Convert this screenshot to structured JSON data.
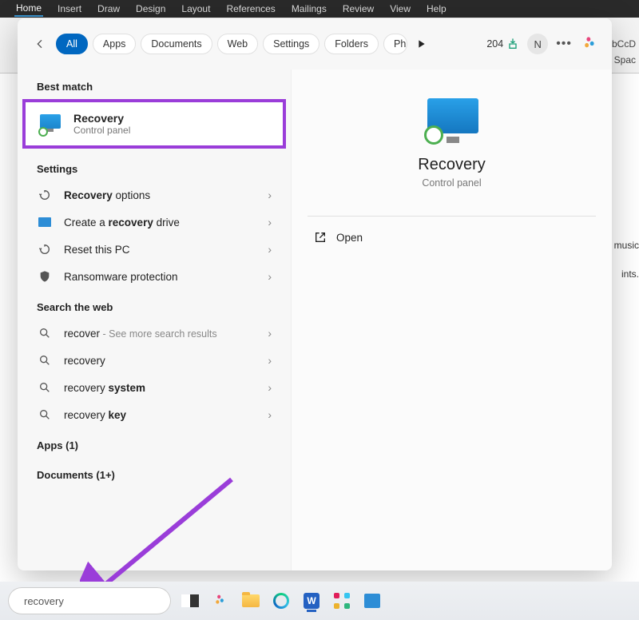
{
  "word_ribbon": {
    "tabs": [
      "Home",
      "Insert",
      "Draw",
      "Design",
      "Layout",
      "References",
      "Mailings",
      "Review",
      "View",
      "Help"
    ]
  },
  "bg": {
    "style_sample": "aBbCcD",
    "style_name": "No Spac",
    "snip1": "d music",
    "snip2": "ints."
  },
  "filters": {
    "all": "All",
    "apps": "Apps",
    "documents": "Documents",
    "web": "Web",
    "settings": "Settings",
    "folders": "Folders",
    "ph": "Ph"
  },
  "top": {
    "rewards": "204",
    "avatar_initial": "N"
  },
  "sections": {
    "best_match": "Best match",
    "settings": "Settings",
    "web": "Search the web",
    "apps": "Apps (1)",
    "documents": "Documents (1+)"
  },
  "best": {
    "title": "Recovery",
    "sub": "Control panel"
  },
  "settings_items": [
    {
      "bold": "Recovery",
      "rest": " options",
      "icon": "recovery"
    },
    {
      "pre": "Create a ",
      "bold": "recovery",
      "rest": " drive",
      "icon": "monitor"
    },
    {
      "bold": "",
      "rest": "Reset this PC",
      "icon": "recovery"
    },
    {
      "bold": "",
      "rest": "Ransomware protection",
      "icon": "shield"
    }
  ],
  "web_items": [
    {
      "bold": "recover",
      "suffix": " - See more search results"
    },
    {
      "bold": "recovery",
      "suffix": ""
    },
    {
      "pre": "recovery ",
      "bold": "system",
      "suffix": ""
    },
    {
      "pre": "recovery ",
      "bold": "key",
      "suffix": ""
    }
  ],
  "preview": {
    "title": "Recovery",
    "sub": "Control panel",
    "open": "Open"
  },
  "taskbar": {
    "search_value": "recovery"
  }
}
